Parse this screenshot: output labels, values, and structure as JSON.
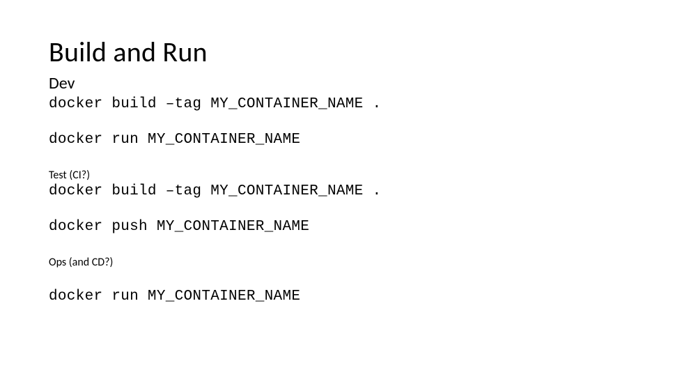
{
  "title": "Build and Run",
  "sections": {
    "dev": {
      "heading": "Dev",
      "cmd_build": "docker build –tag MY_CONTAINER_NAME .",
      "cmd_run": "docker run MY_CONTAINER_NAME"
    },
    "test": {
      "heading": "Test (CI?)",
      "cmd_build": "docker build –tag MY_CONTAINER_NAME .",
      "cmd_push": "docker push MY_CONTAINER_NAME"
    },
    "ops": {
      "heading": "Ops (and CD?)",
      "cmd_run": "docker run MY_CONTAINER_NAME"
    }
  }
}
